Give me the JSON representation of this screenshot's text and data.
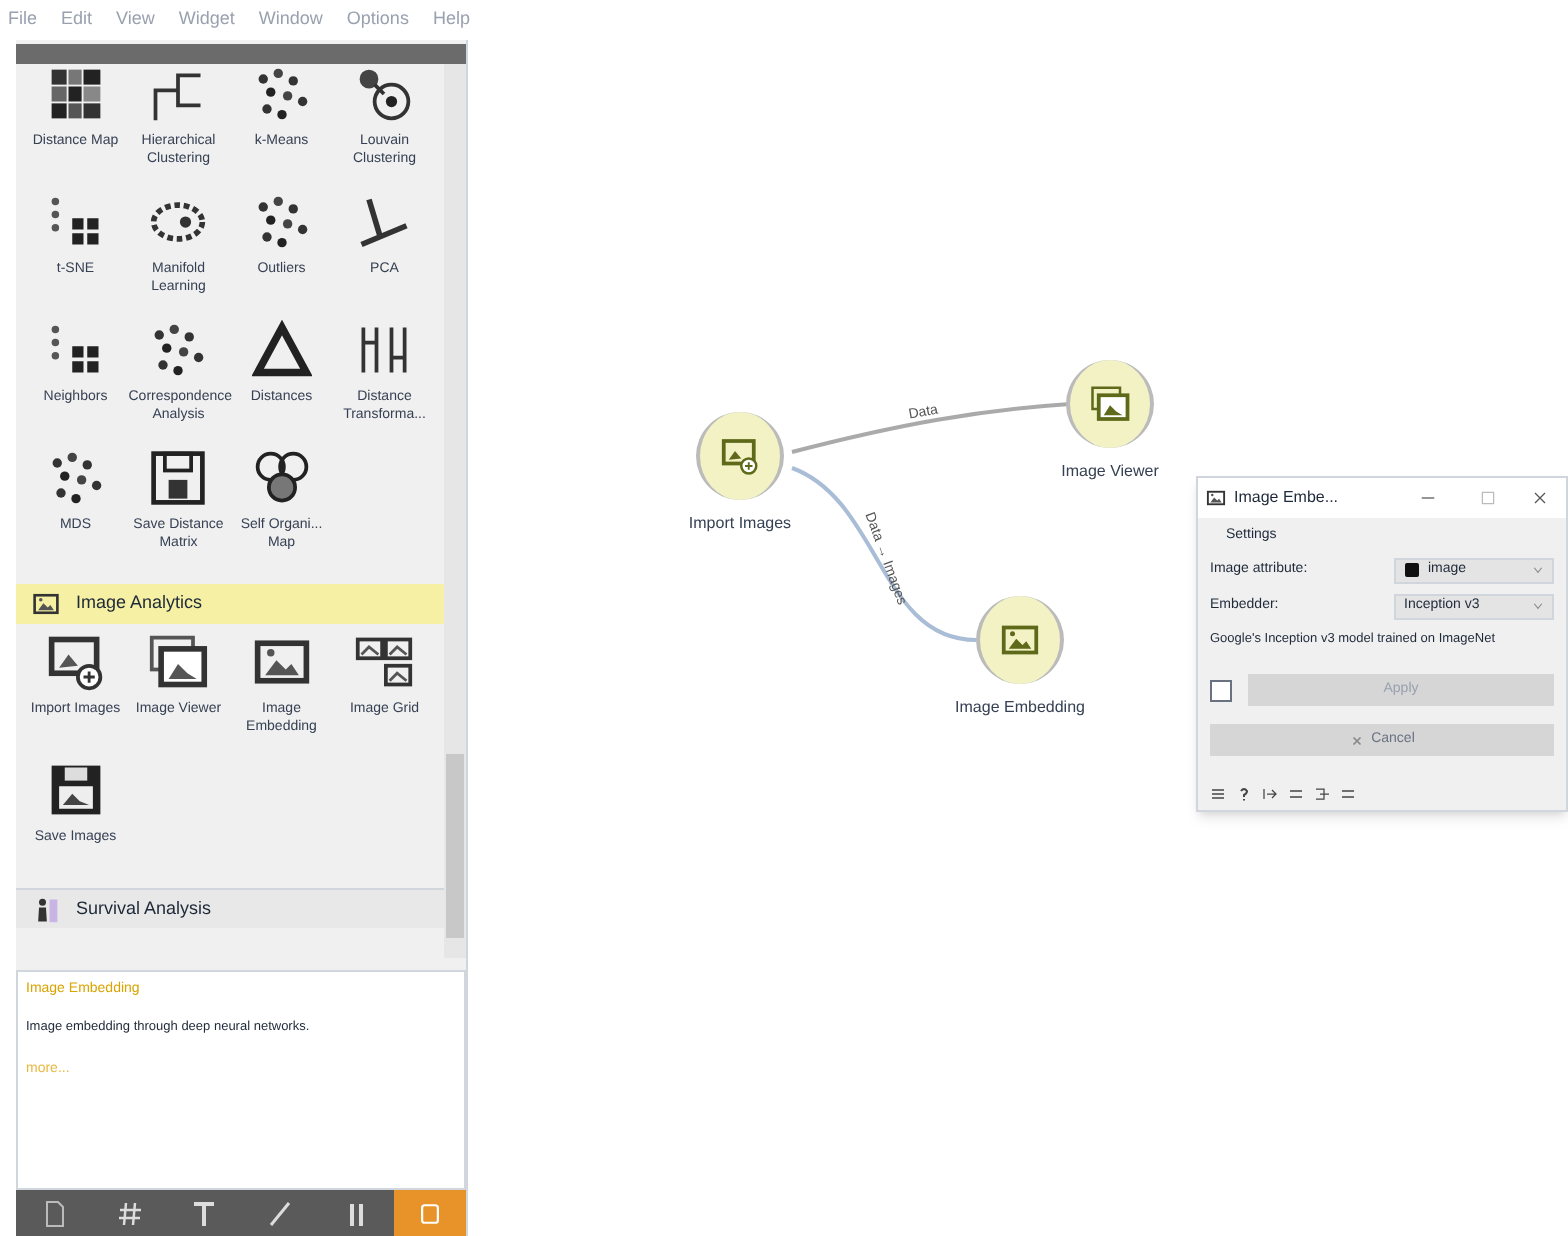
{
  "menu": [
    "File",
    "Edit",
    "View",
    "Widget",
    "Window",
    "Options",
    "Help"
  ],
  "toolbox": {
    "widgets": [
      "Distance Map",
      "Hierarchical Clustering",
      "k-Means",
      "Louvain Clustering",
      "t-SNE",
      "Manifold Learning",
      "Outliers",
      "PCA",
      "Neighbors",
      "Correspondence Analysis",
      "Distances",
      "Distance Transforma...",
      "MDS",
      "Save Distance Matrix",
      "Self Organi... Map"
    ],
    "categories": [
      {
        "name": "Image Analytics",
        "expanded": true,
        "widgets": [
          "Import Images",
          "Image Viewer",
          "Image Embedding",
          "Image Grid",
          "Save Images"
        ]
      },
      {
        "name": "Survival Analysis",
        "expanded": false
      }
    ]
  },
  "help": {
    "title": "Image Embedding",
    "description": "Image embedding through deep neural networks.",
    "link": "more..."
  },
  "canvas": {
    "nodes": [
      {
        "label": "Import Images"
      },
      {
        "label": "Image Viewer"
      },
      {
        "label": "Image Embedding"
      }
    ],
    "links": [
      {
        "label": "Data"
      },
      {
        "label": "Data → Images"
      }
    ]
  },
  "dialog": {
    "title": "Image Embe...",
    "section": "Settings",
    "fields": [
      {
        "label": "Image attribute:",
        "value": "image"
      },
      {
        "label": "Embedder:",
        "value": "Inception v3"
      }
    ],
    "description": "Google's Inception v3 model trained on ImageNet",
    "auto_apply": {
      "checked": false
    },
    "apply": {
      "label": "Apply",
      "disabled": true
    },
    "cancel": {
      "label": "Cancel"
    }
  }
}
